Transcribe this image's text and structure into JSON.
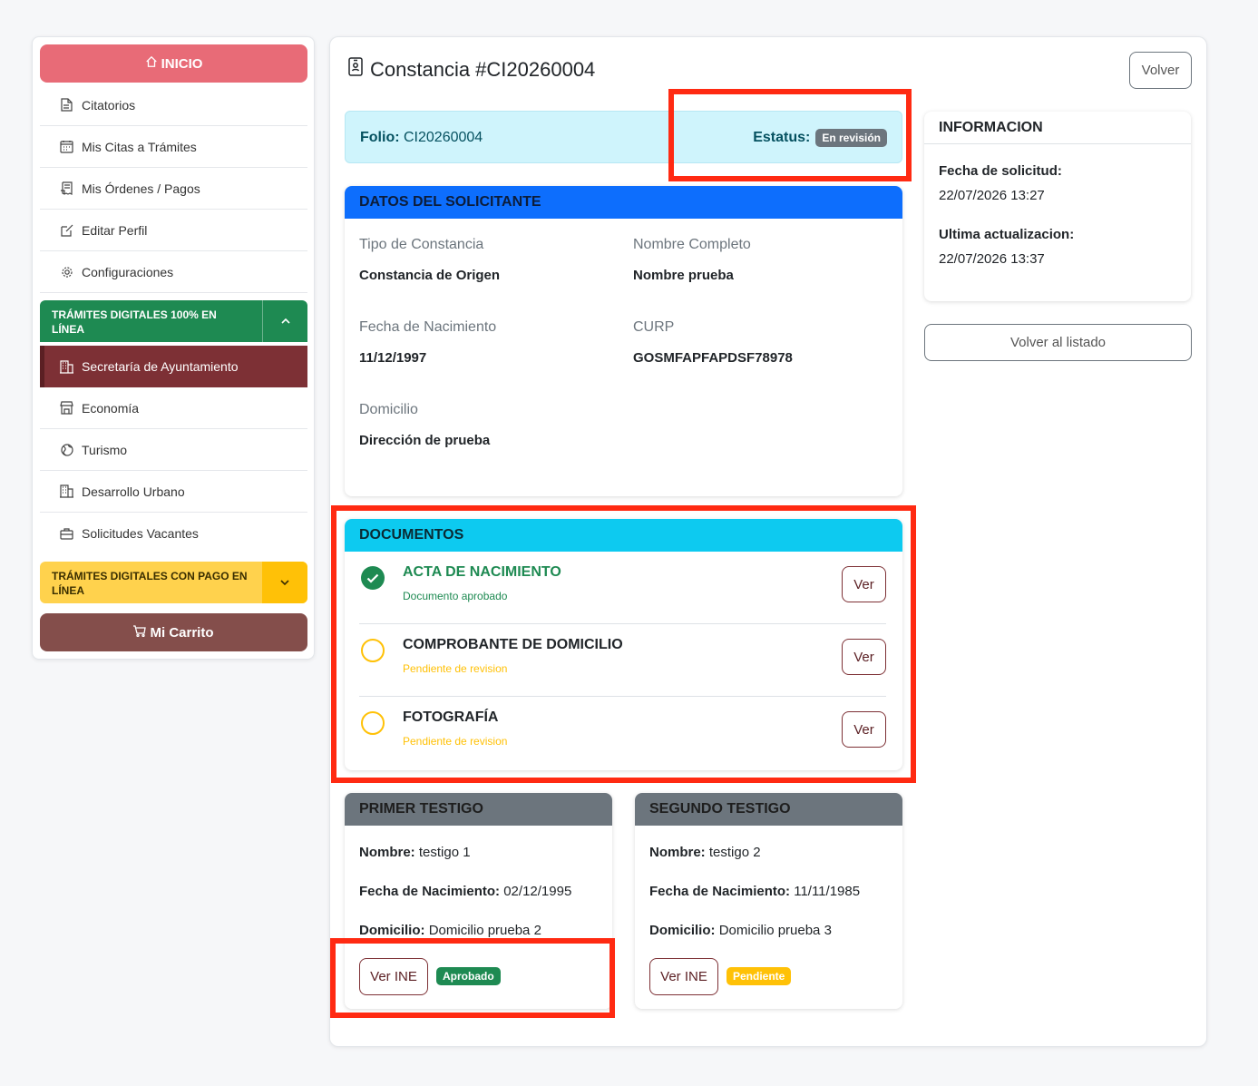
{
  "sidebar": {
    "inicio": "INICIO",
    "items": [
      {
        "label": "Citatorios",
        "icon": "document-icon"
      },
      {
        "label": "Mis Citas a Trámites",
        "icon": "calendar-icon"
      },
      {
        "label": "Mis Órdenes / Pagos",
        "icon": "receipt-icon"
      },
      {
        "label": "Editar Perfil",
        "icon": "edit-icon"
      },
      {
        "label": "Configuraciones",
        "icon": "gear-icon"
      }
    ],
    "group1": "TRÁMITES DIGITALES 100% EN LÍNEA",
    "group1_items": [
      {
        "label": "Secretaría de Ayuntamiento",
        "icon": "building-icon"
      },
      {
        "label": "Economía",
        "icon": "shop-icon"
      },
      {
        "label": "Turismo",
        "icon": "globe-icon"
      },
      {
        "label": "Desarrollo Urbano",
        "icon": "building-icon"
      },
      {
        "label": "Solicitudes Vacantes",
        "icon": "briefcase-icon"
      }
    ],
    "group2": "TRÁMITES DIGITALES CON PAGO EN LÍNEA",
    "carrito": "Mi Carrito"
  },
  "header": {
    "title": "Constancia #CI20260004",
    "volver": "Volver"
  },
  "folio": {
    "label": "Folio:",
    "value": "CI20260004",
    "status_label": "Estatus:",
    "status_value": "En revisión"
  },
  "solicitante": {
    "title": "DATOS DEL SOLICITANTE",
    "tipo_label": "Tipo de Constancia",
    "tipo_value": "Constancia de Origen",
    "nombre_label": "Nombre Completo",
    "nombre_value": "Nombre prueba",
    "fecha_label": "Fecha de Nacimiento",
    "fecha_value": "11/12/1997",
    "curp_label": "CURP",
    "curp_value": "GOSMFAPFAPDSF78978",
    "domicilio_label": "Domicilio",
    "domicilio_value": "Dirección de prueba"
  },
  "documentos": {
    "title": "DOCUMENTOS",
    "ver": "Ver",
    "items": [
      {
        "name": "ACTA DE NACIMIENTO",
        "status": "Documento aprobado"
      },
      {
        "name": "COMPROBANTE DE DOMICILIO",
        "status": "Pendiente de revision"
      },
      {
        "name": "FOTOGRAFÍA",
        "status": "Pendiente de revision"
      }
    ]
  },
  "testigos": {
    "nombre_label": "Nombre:",
    "fecha_label": "Fecha de Nacimiento:",
    "domicilio_label": "Domicilio:",
    "ver_ine": "Ver INE",
    "primero": {
      "title": "PRIMER TESTIGO",
      "nombre": "testigo 1",
      "fecha": "02/12/1995",
      "domicilio": "Domicilio prueba 2",
      "badge": "Aprobado"
    },
    "segundo": {
      "title": "SEGUNDO TESTIGO",
      "nombre": "testigo 2",
      "fecha": "11/11/1985",
      "domicilio": "Domicilio prueba 3",
      "badge": "Pendiente"
    }
  },
  "informacion": {
    "title": "INFORMACION",
    "fecha_solicitud_label": "Fecha de solicitud:",
    "fecha_solicitud": "22/07/2026 13:27",
    "ultima_label": "Ultima actualizacion:",
    "ultima": "22/07/2026 13:37",
    "volver_listado": "Volver al listado"
  },
  "colors": {
    "accent_maroon": "#7d3035",
    "success": "#1e8a52",
    "warning": "#ffc107",
    "highlight": "#ff2a12"
  }
}
